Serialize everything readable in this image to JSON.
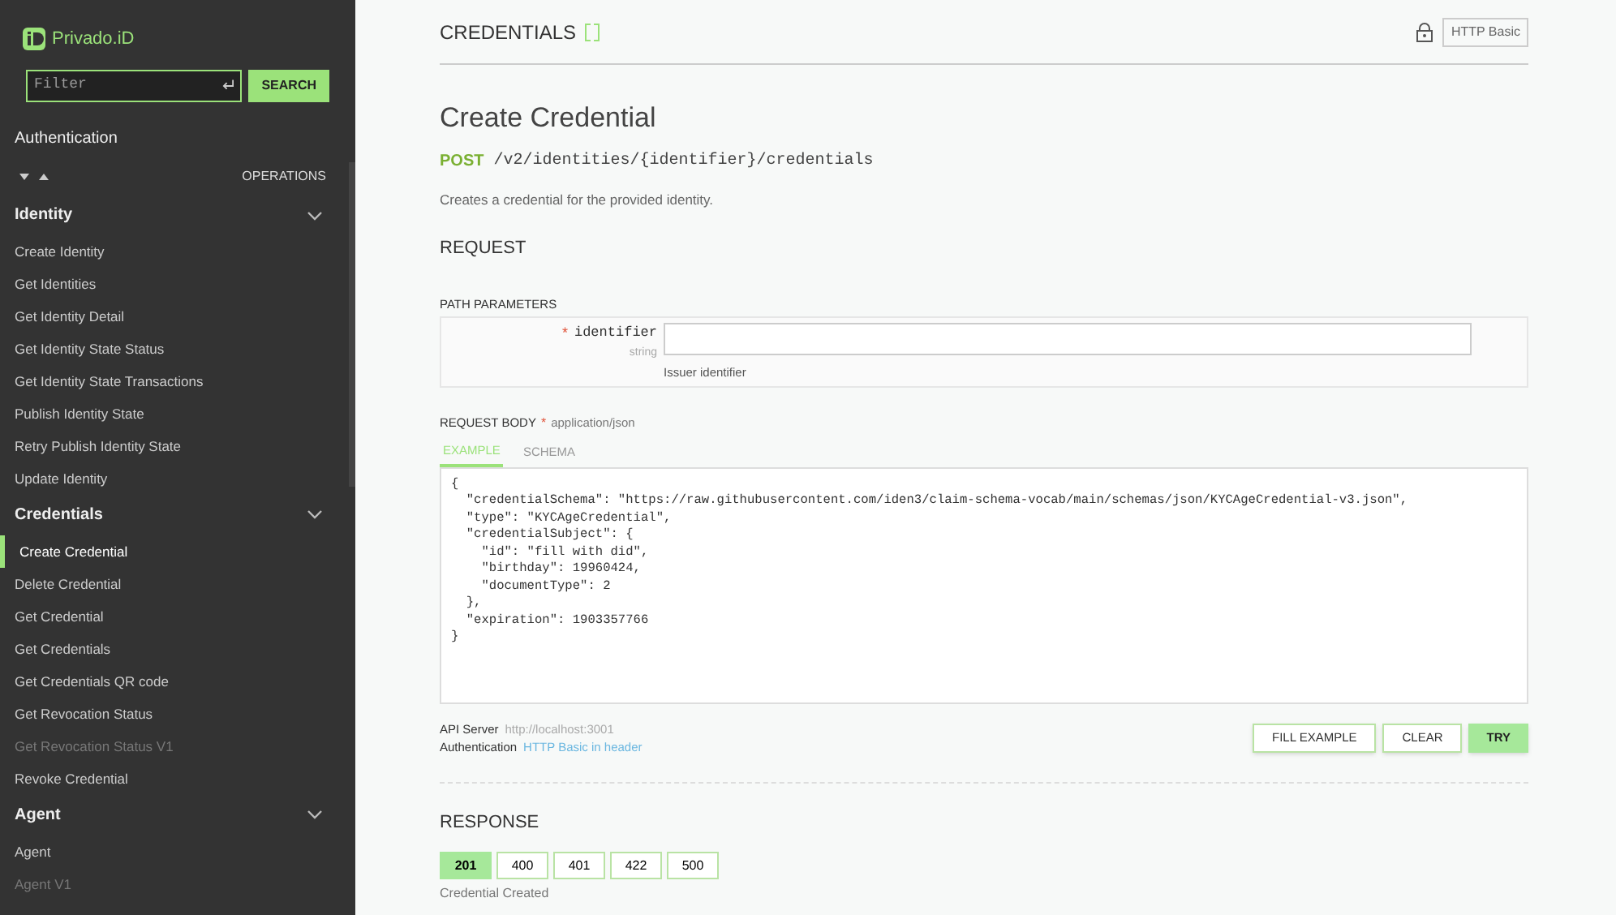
{
  "sidebar": {
    "logo": "Privado.iD",
    "filter": {
      "placeholder": "Filter"
    },
    "search_button": "SEARCH",
    "auth_link": "Authentication",
    "operations_label": "OPERATIONS",
    "groups": [
      {
        "title": "Identity",
        "expanded": true,
        "items": [
          {
            "label": "Create Identity",
            "selected": false,
            "disabled": false
          },
          {
            "label": "Get Identities",
            "selected": false,
            "disabled": false
          },
          {
            "label": "Get Identity Detail",
            "selected": false,
            "disabled": false
          },
          {
            "label": "Get Identity State Status",
            "selected": false,
            "disabled": false
          },
          {
            "label": "Get Identity State Transactions",
            "selected": false,
            "disabled": false
          },
          {
            "label": "Publish Identity State",
            "selected": false,
            "disabled": false
          },
          {
            "label": "Retry Publish Identity State",
            "selected": false,
            "disabled": false
          },
          {
            "label": "Update Identity",
            "selected": false,
            "disabled": false
          }
        ]
      },
      {
        "title": "Credentials",
        "expanded": true,
        "items": [
          {
            "label": "Create Credential",
            "selected": true,
            "disabled": false
          },
          {
            "label": "Delete Credential",
            "selected": false,
            "disabled": false
          },
          {
            "label": "Get Credential",
            "selected": false,
            "disabled": false
          },
          {
            "label": "Get Credentials",
            "selected": false,
            "disabled": false
          },
          {
            "label": "Get Credentials QR code",
            "selected": false,
            "disabled": false
          },
          {
            "label": "Get Revocation Status",
            "selected": false,
            "disabled": false
          },
          {
            "label": "Get Revocation Status V1",
            "selected": false,
            "disabled": true
          },
          {
            "label": "Revoke Credential",
            "selected": false,
            "disabled": false
          }
        ]
      },
      {
        "title": "Agent",
        "expanded": true,
        "items": [
          {
            "label": "Agent",
            "selected": false,
            "disabled": false
          },
          {
            "label": "Agent V1",
            "selected": false,
            "disabled": true
          }
        ]
      }
    ]
  },
  "header": {
    "title": "CREDENTIALS",
    "auth_badge": "HTTP Basic"
  },
  "operation": {
    "title": "Create Credential",
    "method": "POST",
    "path": "/v2/identities/{identifier}/credentials",
    "description": "Creates a credential for the provided identity.",
    "request_heading": "REQUEST",
    "path_params_heading": "PATH PARAMETERS",
    "params": [
      {
        "name": "identifier",
        "required_mark": "*",
        "type": "string",
        "description": "Issuer identifier"
      }
    ],
    "body_label": "REQUEST BODY",
    "body_required_mark": "*",
    "content_type": "application/json",
    "body_tabs": [
      {
        "label": "EXAMPLE",
        "selected": true
      },
      {
        "label": "SCHEMA",
        "selected": false
      }
    ],
    "body_example": "{\n  \"credentialSchema\": \"https://raw.githubusercontent.com/iden3/claim-schema-vocab/main/schemas/json/KYCAgeCredential-v3.json\",\n  \"type\": \"KYCAgeCredential\",\n  \"credentialSubject\": {\n    \"id\": \"fill with did\",\n    \"birthday\": 19960424,\n    \"documentType\": 2\n  },\n  \"expiration\": 1903357766\n}",
    "api_server_label": "API Server",
    "api_server": "http://localhost:3001",
    "auth_label": "Authentication",
    "auth_value": "HTTP Basic in header",
    "buttons": [
      {
        "label": "FILL EXAMPLE",
        "kind": "outline"
      },
      {
        "label": "CLEAR",
        "kind": "outline"
      },
      {
        "label": "TRY",
        "kind": "primary"
      }
    ],
    "response_heading": "RESPONSE",
    "response_codes": [
      {
        "label": "201",
        "selected": true
      },
      {
        "label": "400",
        "selected": false
      },
      {
        "label": "401",
        "selected": false
      },
      {
        "label": "422",
        "selected": false
      },
      {
        "label": "500",
        "selected": false
      }
    ],
    "response_description": "Credential Created"
  }
}
